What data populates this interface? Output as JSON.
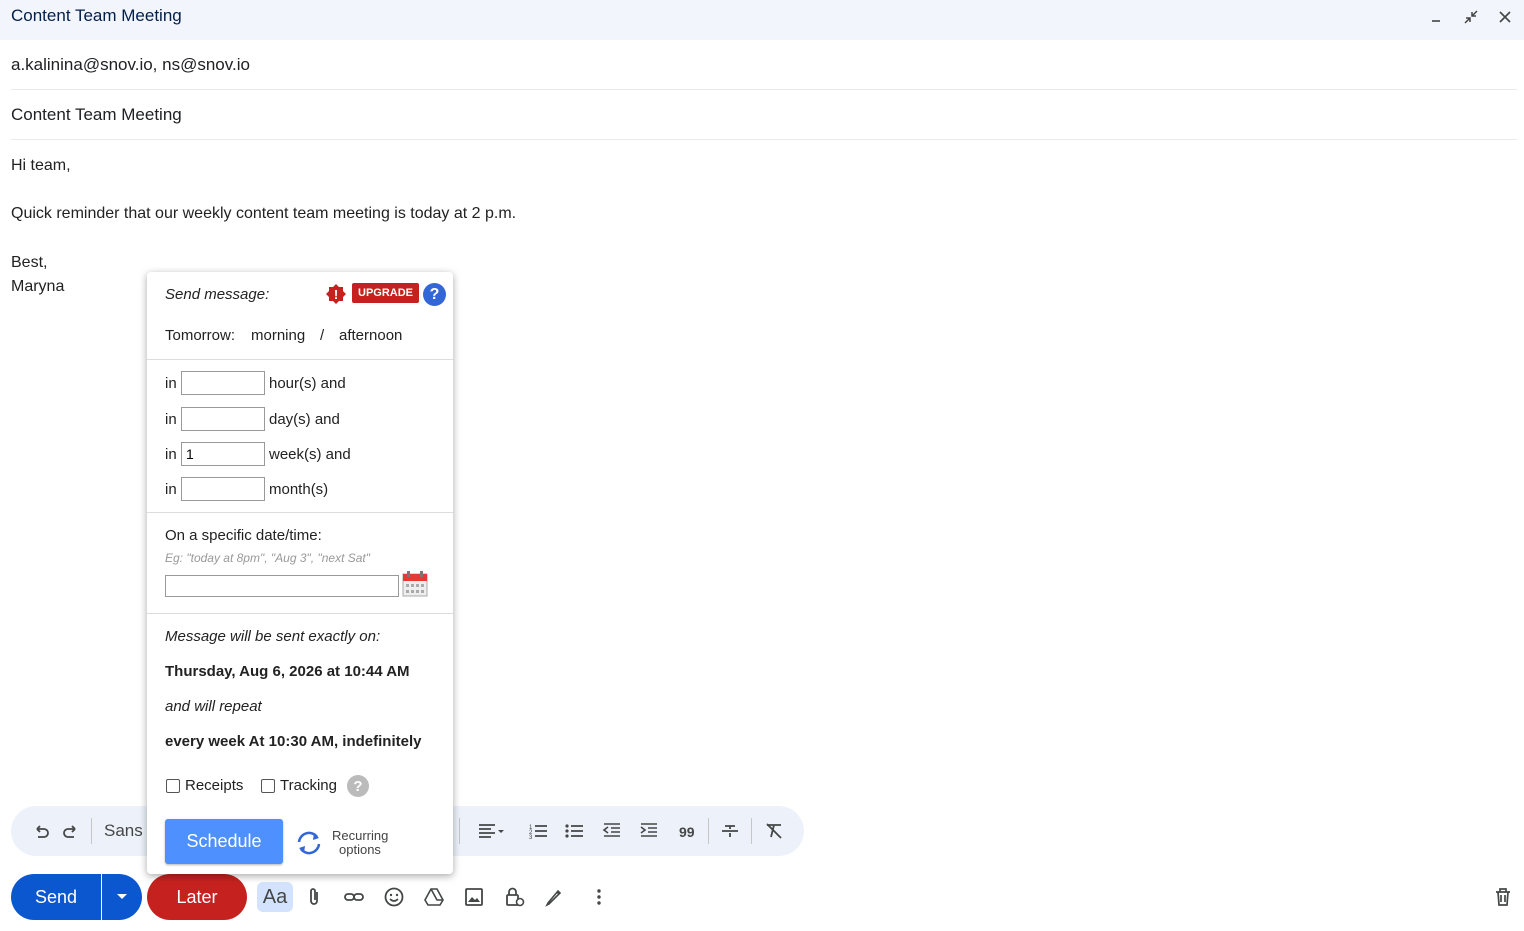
{
  "window": {
    "title": "Content Team Meeting"
  },
  "compose": {
    "to": "a.kalinina@snov.io, ns@snov.io",
    "subject": "Content Team Meeting",
    "body": {
      "greeting": "Hi team,",
      "line1": "Quick reminder that our weekly content team meeting is today at 2 p.m.",
      "signoff": "Best,",
      "name": "Maryna"
    }
  },
  "toolbar": {
    "font": "Sans"
  },
  "bottom": {
    "send_label": "Send",
    "later_label": "Later",
    "format_label": "Aa"
  },
  "scheduler": {
    "heading": "Send message:",
    "upgrade_label": "UPGRADE",
    "help_label": "?",
    "tomorrow_label": "Tomorrow:",
    "morning_label": "morning",
    "slash": "/",
    "afternoon_label": "afternoon",
    "in_label": "in",
    "hours_label": "hour(s) and",
    "days_label": "day(s) and",
    "weeks_label": "week(s) and",
    "months_label": "month(s)",
    "hours_value": "",
    "days_value": "",
    "weeks_value": "1",
    "months_value": "",
    "specific_label": "On a specific date/time:",
    "specific_hint": "Eg: \"today at 8pm\", \"Aug 3\", \"next Sat\"",
    "specific_value": "",
    "sent_exactly_label": "Message will be sent exactly on:",
    "sent_date": "Thursday, Aug 6, 2026 at 10:44 AM",
    "repeat_label": "and will repeat",
    "repeat_value": "every week At 10:30 AM, indefinitely",
    "receipts_label": "Receipts",
    "tracking_label": "Tracking",
    "tracking_help": "?",
    "schedule_label": "Schedule",
    "recurring_line1": "Recurring",
    "recurring_line2": "options"
  },
  "colors": {
    "send": "#0b57d0",
    "later": "#c5221f",
    "schedule": "#4d90fe",
    "upgrade": "#c5221f"
  }
}
